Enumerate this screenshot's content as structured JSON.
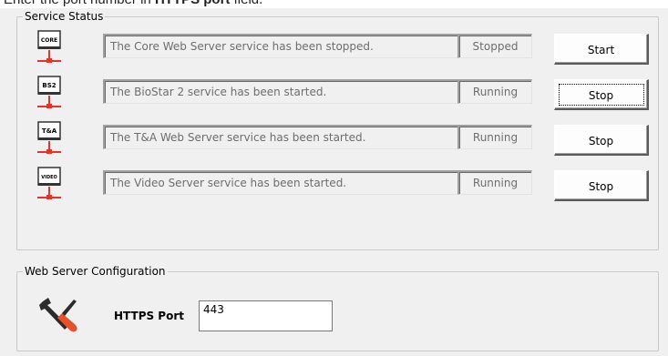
{
  "caption": {
    "prefix": "Enter the port number in ",
    "bold": "HTTPS port",
    "suffix": " field."
  },
  "service_status": {
    "legend": "Service Status",
    "rows": [
      {
        "icon": "core-server-icon",
        "icon_label": "CORE",
        "message": "The Core Web Server service has been stopped.",
        "state": "Stopped",
        "button": "Start"
      },
      {
        "icon": "biostar2-server-icon",
        "icon_label": "BS2",
        "message": "The BioStar 2 service has been started.",
        "state": "Running",
        "button": "Stop"
      },
      {
        "icon": "ta-server-icon",
        "icon_label": "T&A",
        "message": "The T&A Web Server service has been started.",
        "state": "Running",
        "button": "Stop"
      },
      {
        "icon": "video-server-icon",
        "icon_label": "VIDEO",
        "message": "The Video Server service has been started.",
        "state": "Running",
        "button": "Stop"
      }
    ]
  },
  "web_server_config": {
    "legend": "Web Server Configuration",
    "https_port_label": "HTTPS Port",
    "https_port_value": "443"
  },
  "colors": {
    "window_bg": "#f0f0f0",
    "icon_red": "#e5332a",
    "tools_orange": "#e8512a"
  }
}
